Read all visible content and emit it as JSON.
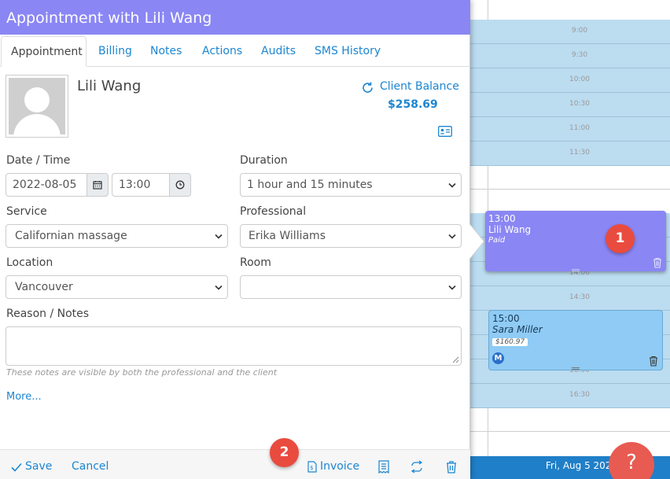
{
  "modal": {
    "title": "Appointment with Lili Wang",
    "tabs": [
      {
        "label": "Appointment",
        "active": true
      },
      {
        "label": "Billing"
      },
      {
        "label": "Notes"
      },
      {
        "label": "Actions"
      },
      {
        "label": "Audits"
      },
      {
        "label": "SMS History"
      }
    ],
    "client": {
      "name": "Lili Wang",
      "balance_label": "Client Balance",
      "balance_value": "$258.69"
    },
    "form": {
      "date_time_label": "Date / Time",
      "date_value": "2022-08-05",
      "time_value": "13:00",
      "duration_label": "Duration",
      "duration_value": "1 hour and 15 minutes",
      "service_label": "Service",
      "service_value": "Californian massage",
      "professional_label": "Professional",
      "professional_value": "Erika Williams",
      "location_label": "Location",
      "location_value": "Vancouver",
      "room_label": "Room",
      "room_value": "",
      "notes_label": "Reason / Notes",
      "notes_hint": "These notes are visible by both the professional and the client",
      "more_link": "More..."
    },
    "footer": {
      "save_label": "Save",
      "cancel_label": "Cancel",
      "invoice_label": "Invoice"
    }
  },
  "calendar": {
    "time_labels": [
      "9:00",
      "9:30",
      "10:00",
      "10:30",
      "11:00",
      "11:30",
      "14:00",
      "14:30",
      "16:00",
      "16:30"
    ],
    "events": [
      {
        "time": "13:00",
        "name": "Lili Wang",
        "status": "Paid"
      },
      {
        "time": "15:00",
        "name": "Sara Miller",
        "price": "$160.97",
        "badge": "M"
      }
    ],
    "footer_date": "Fri, Aug 5 2022",
    "help_label": "?"
  },
  "markers": [
    "1",
    "2"
  ],
  "colors": {
    "header": "#8a86f4",
    "link": "#1c86d1",
    "slot": "#bcdcf0",
    "event_paid": "#8a86f4",
    "event_other": "#8fcbf4",
    "marker": "#e94b3f",
    "calendar_footer": "#1f7fc8"
  }
}
